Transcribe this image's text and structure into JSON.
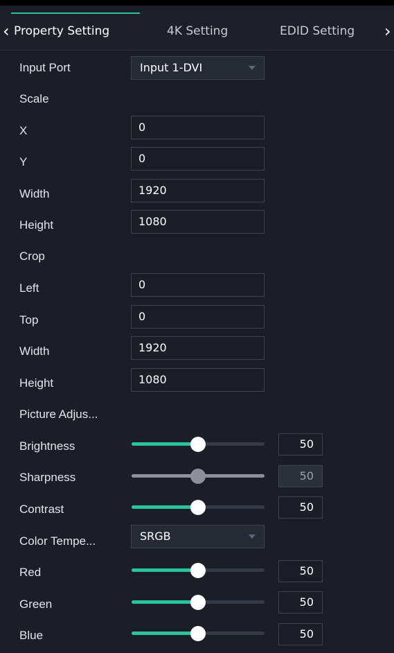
{
  "tabs": [
    {
      "label": "Property Setting",
      "active": true
    },
    {
      "label": "4K Setting",
      "active": false
    },
    {
      "label": "EDID Setting",
      "active": false
    }
  ],
  "icons": {
    "prev": "chevron-left-icon",
    "next": "chevron-right-icon"
  },
  "colors": {
    "accent": "#2bc39b",
    "background": "#1b1e26",
    "disabled": "#8d9099"
  },
  "input_port": {
    "label": "Input Port",
    "value": "Input 1-DVI"
  },
  "scale": {
    "heading": "Scale",
    "x": {
      "label": "X",
      "value": "0"
    },
    "y": {
      "label": "Y",
      "value": "0"
    },
    "width": {
      "label": "Width",
      "value": "1920"
    },
    "height": {
      "label": "Height",
      "value": "1080"
    }
  },
  "crop": {
    "heading": "Crop",
    "left": {
      "label": "Left",
      "value": "0"
    },
    "top": {
      "label": "Top",
      "value": "0"
    },
    "width": {
      "label": "Width",
      "value": "1920"
    },
    "height": {
      "label": "Height",
      "value": "1080"
    }
  },
  "picture": {
    "heading": "Picture Adjus...",
    "brightness": {
      "label": "Brightness",
      "value": "50",
      "level": 0.5,
      "enabled": true
    },
    "sharpness": {
      "label": "Sharpness",
      "value": "50",
      "level": 0.5,
      "enabled": false
    },
    "contrast": {
      "label": "Contrast",
      "value": "50",
      "level": 0.5,
      "enabled": true
    }
  },
  "color_temp": {
    "label": "Color Tempe...",
    "value": "SRGB"
  },
  "rgb": {
    "red": {
      "label": "Red",
      "value": "50",
      "level": 0.5
    },
    "green": {
      "label": "Green",
      "value": "50",
      "level": 0.5
    },
    "blue": {
      "label": "Blue",
      "value": "50",
      "level": 0.5
    }
  }
}
